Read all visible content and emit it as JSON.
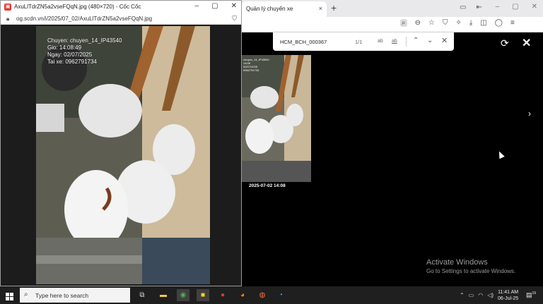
{
  "background_browser": {
    "tab_title": "Quản lý chuyến xe",
    "tab_close": "×",
    "new_tab": "+",
    "find_bar": {
      "query": "HCM_BCH_000367",
      "count": "1/1",
      "match_case": "ab",
      "whole_word": "ab"
    },
    "window_controls": [
      "–",
      "▢",
      "✕"
    ]
  },
  "image_viewer": {
    "thumbnail_overlay": [
      "chuyen_14_IP43540",
      "14:08",
      "02/07/2025",
      "0962791734"
    ],
    "thumbnail_caption": "2025-07-02 14:08",
    "rotate": "⟳",
    "close": "✕",
    "next": "›"
  },
  "popup": {
    "title": "AxuLlTdrZN5a2vseFQqN.jpg (480×720) - Cốc Cốc",
    "url": "og.scdn.vn/i/2025/07_02/AxuLlTdrZN5a2vseFQqN.jpg",
    "window_controls": [
      "–",
      "▢",
      "✕"
    ],
    "photo_overlay": [
      "Chuyen: chuyen_14_IP43540",
      "Gio: 14:08:49",
      "Ngay: 02/07/2025",
      "Tai xe: 0962791734"
    ]
  },
  "watermark": {
    "title": "Activate Windows",
    "subtitle": "Go to Settings to activate Windows."
  },
  "taskbar": {
    "search_placeholder": "Type here to search",
    "time": "11:41 AM",
    "date": "06-Jul-25",
    "notification_count": "19"
  }
}
